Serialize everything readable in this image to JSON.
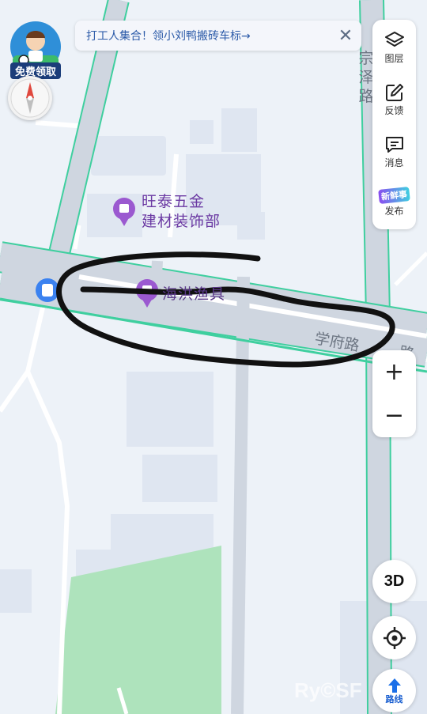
{
  "banner": {
    "text": "打工人集合！领小刘鸭搬砖车标→",
    "close_icon": "close-icon"
  },
  "promo": {
    "label": "免费领取",
    "icon": "avatar-character-icon"
  },
  "compass": {
    "icon": "compass-icon"
  },
  "toolbar": {
    "layers_label": "图层",
    "feedback_label": "反馈",
    "messages_label": "消息",
    "publish_label": "发布",
    "publish_badge": "新鲜事"
  },
  "zoom": {
    "in_label": "+",
    "out_label": "−"
  },
  "btn_3d": "3D",
  "locate_icon": "locate-icon",
  "route": {
    "label": "路线"
  },
  "map": {
    "poi_1_line1": "旺泰五金",
    "poi_1_line2": "建材装饰部",
    "poi_2": "海洪渔具",
    "street_1": "学府路",
    "street_1_tail": "路",
    "street_2": "宗泽路",
    "colors": {
      "road": "#cfd6e0",
      "road_edge": "#3fcf9f",
      "block": "#dfe6f0",
      "green": "#a9e0b4",
      "poi_purple": "#9b59d0",
      "annotation": "#111111"
    }
  },
  "watermark": "Ry©SF"
}
